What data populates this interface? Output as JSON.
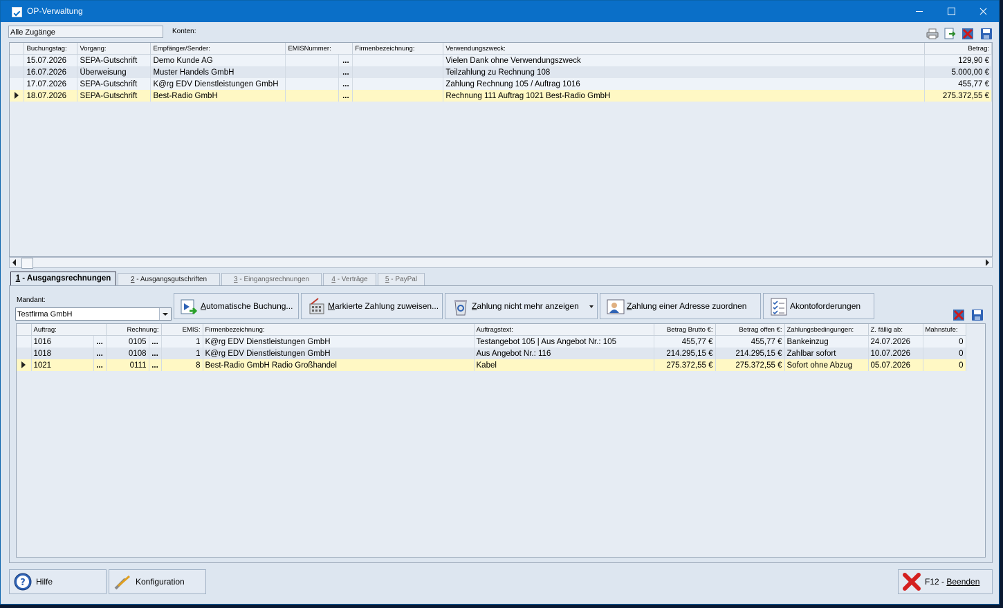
{
  "window": {
    "title": "OP-Verwaltung"
  },
  "top": {
    "filter_value": "Alle Zugänge",
    "konten_label": "Konten:",
    "columns": [
      "Buchungstag:",
      "Vorgang:",
      "Empfänger/Sender:",
      "EMISNummer:",
      "Firmenbezeichnung:",
      "Verwendungszweck:",
      "Betrag:"
    ],
    "rows": [
      {
        "date": "15.07.2026",
        "vorgang": "SEPA-Gutschrift",
        "empf": "Demo Kunde AG",
        "emis": "",
        "dots": "...",
        "firma": "",
        "zweck": "Vielen Dank ohne Verwendungszweck",
        "betrag": "129,90 €"
      },
      {
        "date": "16.07.2026",
        "vorgang": "Überweisung",
        "empf": "Muster Handels GmbH",
        "emis": "",
        "dots": "...",
        "firma": "",
        "zweck": "Teilzahlung zu Rechnung 108",
        "betrag": "5.000,00 €"
      },
      {
        "date": "17.07.2026",
        "vorgang": "SEPA-Gutschrift",
        "empf": "K@rg EDV Dienstleistungen GmbH",
        "emis": "",
        "dots": "...",
        "firma": "",
        "zweck": "Zahlung Rechnung 105 / Auftrag 1016",
        "betrag": "455,77 €"
      },
      {
        "date": "18.07.2026",
        "vorgang": "SEPA-Gutschrift",
        "empf": "Best-Radio GmbH",
        "emis": "",
        "dots": "...",
        "firma": "",
        "zweck": "Rechnung 111 Auftrag 1021 Best-Radio GmbH",
        "betrag": "275.372,55 €"
      }
    ]
  },
  "tabs": [
    {
      "num": "1",
      "label": " - Ausgangsrechnungen"
    },
    {
      "num": "2",
      "label": " - Ausgangsgutschriften"
    },
    {
      "num": "3",
      "label": " - Eingangsrechnungen"
    },
    {
      "num": "4",
      "label": " - Verträge"
    },
    {
      "num": "5",
      "label": " - PayPal"
    }
  ],
  "mandant": {
    "label": "Mandant:",
    "value": "Testfirma GmbH"
  },
  "actions": {
    "auto": "Automatische Buchung...",
    "markiert": "Markierte Zahlung zuweisen...",
    "hide": "Zahlung nicht mehr anzeigen",
    "address": "Zahlung einer Adresse zuordnen",
    "akonto": "Akontoforderungen"
  },
  "bottom": {
    "columns": [
      "Auftrag:",
      "Rechnung:",
      "EMIS:",
      "Firmenbezeichnung:",
      "Auftragstext:",
      "Betrag Brutto €:",
      "Betrag offen €:",
      "Zahlungsbedingungen:",
      "Z. fällig ab:",
      "Mahnstufe:"
    ],
    "rows": [
      {
        "auftrag": "1016",
        "rechnung": "0105",
        "emis": "1",
        "firma": "K@rg EDV Dienstleistungen GmbH",
        "text": "Testangebot 105 | Aus Angebot Nr.: 105",
        "brutto": "455,77 €",
        "offen": "455,77 €",
        "zb": "Bankeinzug",
        "faellig": "24.07.2026",
        "mahn": "0"
      },
      {
        "auftrag": "1018",
        "rechnung": "0108",
        "emis": "1",
        "firma": "K@rg EDV Dienstleistungen GmbH",
        "text": "Aus Angebot Nr.: 116",
        "brutto": "214.295,15 €",
        "offen": "214.295,15 €",
        "zb": "Zahlbar sofort",
        "faellig": "10.07.2026",
        "mahn": "0"
      },
      {
        "auftrag": "1021",
        "rechnung": "0111",
        "emis": "8",
        "firma": "Best-Radio GmbH Radio Großhandel",
        "text": "Kabel",
        "brutto": "275.372,55 €",
        "offen": "275.372,55 €",
        "zb": "Sofort ohne Abzug",
        "faellig": "05.07.2026",
        "mahn": "0"
      }
    ],
    "dots": "..."
  },
  "footer": {
    "hilfe": "Hilfe",
    "konfig": "Konfiguration",
    "beenden_key": "F12 - ",
    "beenden": "Beenden"
  }
}
